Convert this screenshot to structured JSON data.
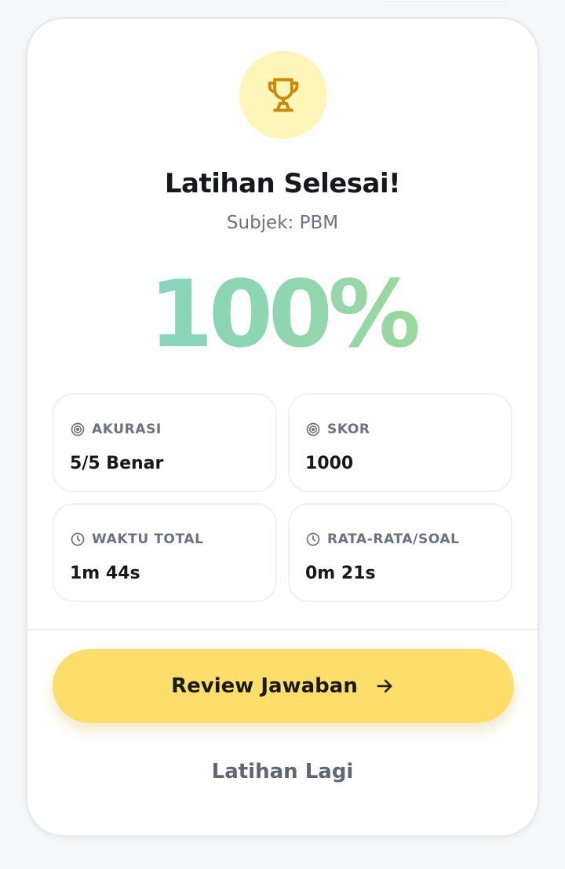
{
  "result": {
    "title": "Latihan Selesai!",
    "subtitle": "Subjek: PBM",
    "percentage": "100%"
  },
  "stats": [
    {
      "icon": "target-icon",
      "label": "AKURASI",
      "value": "5/5 Benar"
    },
    {
      "icon": "target-icon",
      "label": "SKOR",
      "value": "1000"
    },
    {
      "icon": "clock-icon",
      "label": "WAKTU TOTAL",
      "value": "1m 44s"
    },
    {
      "icon": "clock-icon",
      "label": "RATA-RATA/SOAL",
      "value": "0m 21s"
    }
  ],
  "actions": {
    "review_label": "Review Jawaban",
    "again_label": "Latihan Lagi"
  },
  "colors": {
    "accent_yellow": "#fdde6a",
    "trophy_bg": "#fef6b8",
    "trophy_icon": "#c98a0b",
    "gradient_start": "#7dd3c8",
    "gradient_end": "#a7d98b",
    "muted_text": "#6b7280"
  }
}
